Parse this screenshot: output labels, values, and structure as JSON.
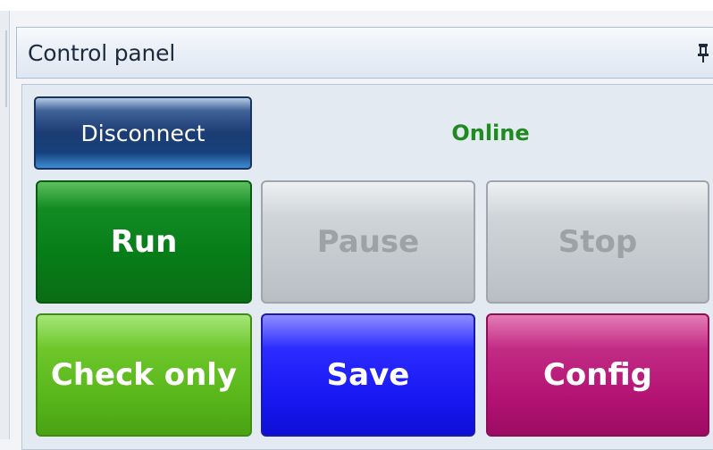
{
  "panel": {
    "title": "Control panel",
    "pin_icon": "pin-icon"
  },
  "connection": {
    "disconnect_label": "Disconnect",
    "status_text": "Online",
    "status_color": "#1f8a1f"
  },
  "buttons": {
    "run": {
      "label": "Run",
      "color": "#077d18",
      "enabled": true
    },
    "pause": {
      "label": "Pause",
      "color": "#c3c8cd",
      "enabled": false
    },
    "stop": {
      "label": "Stop",
      "color": "#c3c8cd",
      "enabled": false
    },
    "check_only": {
      "label": "Check only",
      "color": "#58b51a",
      "enabled": true
    },
    "save": {
      "label": "Save",
      "color": "#1717f2",
      "enabled": true
    },
    "config": {
      "label": "Config",
      "color": "#b31273",
      "enabled": true
    }
  }
}
